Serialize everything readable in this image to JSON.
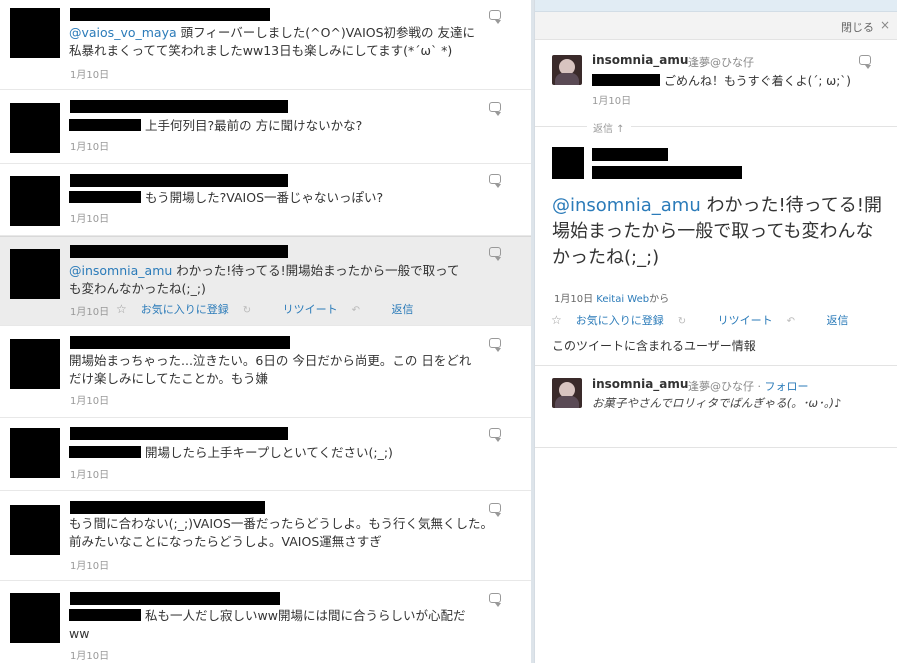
{
  "timeline": {
    "tweets": [
      {
        "mention": "@vaios_vo_maya",
        "text_line1": " 頭フィーバーしました(^O^)VAIOS初参戦の 友達に",
        "text_line2": "私暴れまくってて笑われましたww13日も楽しみにしてます(*´ω` *)",
        "date": "1月10日"
      },
      {
        "mention": "",
        "text_line1": "上手何列目?最前の 方に聞けないかな?",
        "text_line2": "",
        "date": "1月10日"
      },
      {
        "mention": "",
        "text_line1": "もう開場した?VAIOS一番じゃないっぽい?",
        "text_line2": "",
        "date": "1月10日"
      },
      {
        "mention": "@insomnia_amu",
        "text_line1": " わかった!待ってる!開場始まったから一般で取って",
        "text_line2": "も変わんなかったね(;_;)",
        "date": "1月10日",
        "actions": {
          "favorite": "お気に入りに登録",
          "retweet": "リツイート",
          "reply": "返信"
        }
      },
      {
        "mention": "",
        "text_line1": "開場始まっちゃった...泣きたい。6日の 今日だから尚更。この 日をどれ",
        "text_line2": "だけ楽しみにしてたことか。もう嫌",
        "date": "1月10日"
      },
      {
        "mention": "",
        "text_line1": "開場したら上手キープしといてください(;_;)",
        "text_line2": "",
        "date": "1月10日"
      },
      {
        "mention": "",
        "text_line1": "もう間に合わない(;_;)VAIOS一番だったらどうしよ。もう行く気無くした。",
        "text_line2": "前みたいなことになったらどうしよ。VAIOS運無さすぎ",
        "date": "1月10日"
      },
      {
        "mention": "",
        "text_line1": "私も一人だし寂しいww開場には間に合うらしいが心配だ",
        "text_line2": "ww",
        "date": "1月10日"
      }
    ]
  },
  "details": {
    "close_label": "閉じる",
    "close_icon": "×",
    "parent": {
      "username": "insomnia_amu",
      "display_name": "逢夢@ひな仔",
      "text": "ごめんね！もうすぐ着くよ(´; ω;`)",
      "date": "1月10日"
    },
    "reply_label": "返信 ↑",
    "main": {
      "mention": "@insomnia_amu",
      "text_rest": " わかった!待ってる!開場始まったから一般で取っても変わんなかったね(;_;)",
      "date": "1月10日",
      "via": "Keitai Web",
      "via_suffix": "から",
      "actions": {
        "favorite": "お気に入りに登録",
        "retweet": "リツイート",
        "reply": "返信"
      }
    },
    "users_heading": "このツイートに含まれるユーザー情報",
    "user": {
      "username": "insomnia_amu",
      "display_name": "逢夢@ひな仔",
      "follow_label": "フォロー",
      "bio": "お菓子やさんでロリィタでばんぎゃる(。･ω･。)♪"
    }
  },
  "colors": {
    "link": "#2b7bb9",
    "highlight_bg": "#ececec",
    "pane_border": "#d5dce3"
  }
}
